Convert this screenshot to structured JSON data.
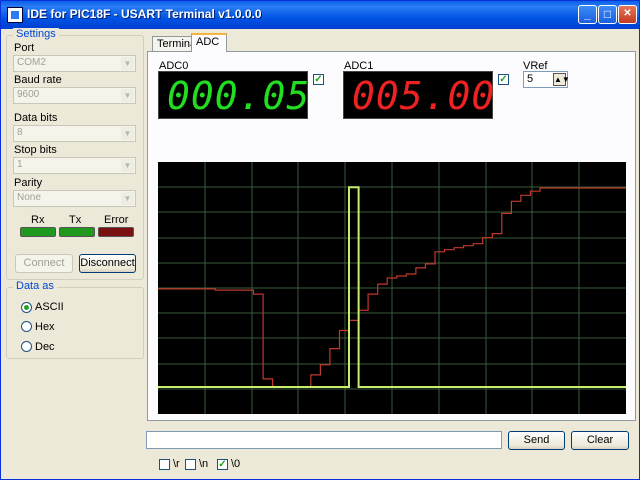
{
  "window": {
    "title": "IDE for PIC18F - USART Terminal v1.0.0.0",
    "min": "_",
    "max": "□",
    "close": "✕"
  },
  "settings": {
    "title": "Settings",
    "port": {
      "label": "Port",
      "value": "COM2"
    },
    "baud": {
      "label": "Baud rate",
      "value": "9600"
    },
    "databits": {
      "label": "Data bits",
      "value": "8"
    },
    "stopbits": {
      "label": "Stop bits",
      "value": "1"
    },
    "parity": {
      "label": "Parity",
      "value": "None"
    },
    "leds": [
      {
        "label": "Rx",
        "color": "#1f9a1f"
      },
      {
        "label": "Tx",
        "color": "#1f9a1f"
      },
      {
        "label": "Error",
        "color": "#7a1010"
      }
    ],
    "connect": "Connect",
    "disconnect": "Disconnect"
  },
  "dataas": {
    "title": "Data as",
    "options": [
      "ASCII",
      "Hex",
      "Dec"
    ],
    "selected": "ASCII"
  },
  "tabs": [
    {
      "label": "Terminal"
    },
    {
      "label": "ADC",
      "active": true
    }
  ],
  "adc0": {
    "label": "ADC0",
    "value": "000.05",
    "color": "#22dd22",
    "checked": true
  },
  "adc1": {
    "label": "ADC1",
    "value": "005.00",
    "color": "#ee2222",
    "checked": true
  },
  "vref": {
    "label": "VRef",
    "value": "5"
  },
  "plot": {
    "grid_color": "#3a5a3a",
    "series": [
      {
        "color": "#c0392b",
        "values": [
          2.48,
          2.48,
          2.48,
          2.48,
          2.48,
          2.48,
          2.45,
          2.45,
          2.45,
          2.45,
          2.35,
          0.25,
          0.05,
          0.05,
          0.05,
          0.05,
          0.35,
          0.6,
          1.0,
          1.45,
          1.7,
          1.95,
          2.35,
          2.6,
          2.75,
          2.8,
          2.85,
          3.0,
          3.1,
          3.4,
          3.45,
          3.5,
          3.55,
          3.6,
          3.75,
          3.85,
          4.35,
          4.65,
          4.8,
          4.9,
          4.98,
          4.98,
          4.98,
          4.98,
          4.98,
          4.98,
          4.98,
          4.98,
          4.98,
          4.98
        ]
      },
      {
        "color": "#c8ec6c",
        "values": [
          0.05,
          0.05,
          0.05,
          0.05,
          0.05,
          0.05,
          0.05,
          0.05,
          0.05,
          0.05,
          0.05,
          0.05,
          0.05,
          0.05,
          0.05,
          0.05,
          0.05,
          0.05,
          0.05,
          0.05,
          5.0,
          0.05,
          0.05,
          0.05,
          0.05,
          0.05,
          0.05,
          0.05,
          0.05,
          0.05,
          0.05,
          0.05,
          0.05,
          0.05,
          0.05,
          0.05,
          0.05,
          0.05,
          0.05,
          0.05,
          0.05,
          0.05,
          0.05,
          0.05,
          0.05,
          0.05,
          0.05,
          0.05,
          0.05,
          0.05
        ]
      }
    ],
    "ymax": 5.5
  },
  "send": "Send",
  "clear": "Clear",
  "options": [
    {
      "label": "\\r",
      "checked": false
    },
    {
      "label": "\\n",
      "checked": false
    },
    {
      "label": "\\0",
      "checked": true
    }
  ]
}
